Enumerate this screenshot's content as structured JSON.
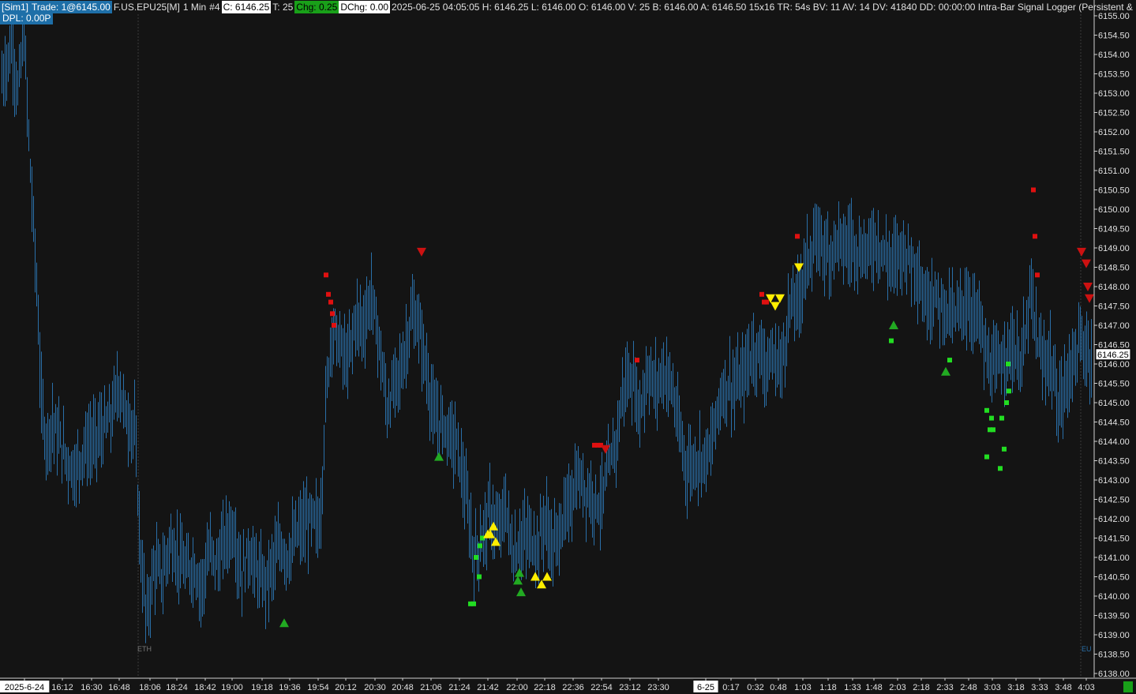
{
  "header": {
    "sim": "[Sim1]",
    "trade": "Trade: 1@6145.00",
    "symbol": "F.US.EPU25[M]",
    "timeframe": "1 Min",
    "bar_index": "#4",
    "close": "C: 6146.25",
    "ticks": "T: 25",
    "chg": "Chg: 0.25",
    "dchg": "DChg: 0.00",
    "info": "2025-06-25 04:05:05 H: 6146.25 L: 6146.00 O: 6146.00 V: 25 B: 6146.00 A: 6146.50 15x16 TR: 54s BV: 11 AV: 14 DV: 41840 DD: 00:00:00 Intra-Bar Signal Logger (Persistent & Precise)"
  },
  "dpl": "DPL: 0.00P",
  "session_labels": {
    "eth": "ETH",
    "eu": "EU"
  },
  "colors": {
    "background": "#141414",
    "bars": "#2a6fa8",
    "buy_square": "#22dd22",
    "sell_square": "#e01010",
    "buy_triangle": "#22aa22",
    "sell_triangle": "#cc1111",
    "alert_triangle": "#ffee00",
    "axis_text": "#e0e0e0"
  },
  "chart_data": {
    "type": "ohlc",
    "ylim": [
      6138.0,
      6155.2
    ],
    "y_ticks": [
      "6155.00",
      "6154.50",
      "6154.00",
      "6153.50",
      "6153.00",
      "6152.50",
      "6152.00",
      "6151.50",
      "6151.00",
      "6150.50",
      "6150.00",
      "6149.50",
      "6149.00",
      "6148.50",
      "6148.00",
      "6147.50",
      "6147.00",
      "6146.50",
      "6146.00",
      "6145.50",
      "6145.00",
      "6144.50",
      "6144.00",
      "6143.50",
      "6143.00",
      "6142.50",
      "6142.00",
      "6141.50",
      "6141.00",
      "6140.50",
      "6140.00",
      "6139.50",
      "6139.00",
      "6138.50",
      "6138.00"
    ],
    "current_price": "6146.25",
    "x_ticks": [
      "2025-6-24",
      "16:12",
      "16:30",
      "16:48",
      "18:06",
      "18:24",
      "18:42",
      "19:00",
      "19:18",
      "19:36",
      "19:54",
      "20:12",
      "20:30",
      "20:48",
      "21:06",
      "21:24",
      "21:42",
      "22:00",
      "22:18",
      "22:36",
      "22:54",
      "23:12",
      "23:30",
      "6-25",
      "0:17",
      "0:32",
      "0:48",
      "1:03",
      "1:18",
      "1:33",
      "1:48",
      "2:03",
      "2:18",
      "2:33",
      "2:48",
      "3:03",
      "3:18",
      "3:33",
      "3:48",
      "4:03"
    ],
    "price_path": [
      [
        0,
        6153.2
      ],
      [
        8,
        6153.8
      ],
      [
        15,
        6154.2
      ],
      [
        22,
        6153.0
      ],
      [
        30,
        6154.5
      ],
      [
        38,
        6151.0
      ],
      [
        45,
        6148.5
      ],
      [
        52,
        6145.0
      ],
      [
        58,
        6144.0
      ],
      [
        66,
        6144.5
      ],
      [
        75,
        6144.0
      ],
      [
        85,
        6143.5
      ],
      [
        95,
        6143.2
      ],
      [
        105,
        6143.8
      ],
      [
        118,
        6144.0
      ],
      [
        130,
        6144.3
      ],
      [
        140,
        6144.6
      ],
      [
        150,
        6145.5
      ],
      [
        160,
        6144.6
      ],
      [
        170,
        6144.3
      ],
      [
        178,
        6141.0
      ],
      [
        185,
        6139.4
      ],
      [
        195,
        6140.8
      ],
      [
        205,
        6140.5
      ],
      [
        215,
        6141.4
      ],
      [
        225,
        6141.0
      ],
      [
        235,
        6140.6
      ],
      [
        245,
        6140.8
      ],
      [
        255,
        6140.2
      ],
      [
        265,
        6141.2
      ],
      [
        275,
        6140.8
      ],
      [
        285,
        6141.5
      ],
      [
        295,
        6141.8
      ],
      [
        305,
        6140.5
      ],
      [
        315,
        6141.2
      ],
      [
        325,
        6140.6
      ],
      [
        335,
        6140.3
      ],
      [
        345,
        6140.8
      ],
      [
        355,
        6141.3
      ],
      [
        365,
        6141.0
      ],
      [
        375,
        6141.6
      ],
      [
        385,
        6141.8
      ],
      [
        395,
        6142.0
      ],
      [
        405,
        6141.8
      ],
      [
        412,
        6145.0
      ],
      [
        420,
        6147.0
      ],
      [
        430,
        6146.5
      ],
      [
        440,
        6146.0
      ],
      [
        450,
        6147.2
      ],
      [
        460,
        6147.0
      ],
      [
        470,
        6147.8
      ],
      [
        480,
        6146.5
      ],
      [
        490,
        6144.8
      ],
      [
        500,
        6145.5
      ],
      [
        510,
        6146.0
      ],
      [
        520,
        6147.2
      ],
      [
        530,
        6147.0
      ],
      [
        540,
        6145.8
      ],
      [
        550,
        6144.5
      ],
      [
        560,
        6144.5
      ],
      [
        570,
        6144.2
      ],
      [
        580,
        6143.8
      ],
      [
        590,
        6142.5
      ],
      [
        600,
        6141.0
      ],
      [
        610,
        6141.5
      ],
      [
        620,
        6142.2
      ],
      [
        630,
        6141.6
      ],
      [
        640,
        6142.3
      ],
      [
        650,
        6141.0
      ],
      [
        660,
        6141.5
      ],
      [
        670,
        6141.5
      ],
      [
        680,
        6141.3
      ],
      [
        690,
        6142.0
      ],
      [
        700,
        6141.2
      ],
      [
        710,
        6141.8
      ],
      [
        720,
        6142.3
      ],
      [
        730,
        6143.0
      ],
      [
        740,
        6142.8
      ],
      [
        750,
        6142.6
      ],
      [
        760,
        6142.4
      ],
      [
        770,
        6143.2
      ],
      [
        780,
        6144.0
      ],
      [
        790,
        6145.5
      ],
      [
        800,
        6145.6
      ],
      [
        810,
        6144.8
      ],
      [
        820,
        6145.8
      ],
      [
        830,
        6145.4
      ],
      [
        840,
        6145.8
      ],
      [
        850,
        6145.5
      ],
      [
        860,
        6144.2
      ],
      [
        870,
        6143.3
      ],
      [
        880,
        6143.5
      ],
      [
        890,
        6143.6
      ],
      [
        900,
        6143.8
      ],
      [
        910,
        6145.0
      ],
      [
        920,
        6145.5
      ],
      [
        930,
        6145.4
      ],
      [
        940,
        6145.6
      ],
      [
        950,
        6146.2
      ],
      [
        960,
        6146.4
      ],
      [
        970,
        6146.0
      ],
      [
        980,
        6146.1
      ],
      [
        990,
        6146.0
      ],
      [
        1000,
        6147.5
      ],
      [
        1010,
        6147.6
      ],
      [
        1020,
        6148.6
      ],
      [
        1030,
        6149.0
      ],
      [
        1040,
        6149.2
      ],
      [
        1050,
        6148.8
      ],
      [
        1060,
        6149.3
      ],
      [
        1070,
        6149.0
      ],
      [
        1080,
        6149.2
      ],
      [
        1090,
        6148.8
      ],
      [
        1100,
        6149.0
      ],
      [
        1110,
        6149.2
      ],
      [
        1120,
        6148.8
      ],
      [
        1130,
        6148.6
      ],
      [
        1140,
        6149.0
      ],
      [
        1150,
        6148.8
      ],
      [
        1160,
        6148.6
      ],
      [
        1170,
        6147.6
      ],
      [
        1180,
        6147.8
      ],
      [
        1190,
        6147.6
      ],
      [
        1200,
        6147.4
      ],
      [
        1210,
        6147.2
      ],
      [
        1220,
        6147.6
      ],
      [
        1230,
        6147.4
      ],
      [
        1240,
        6147.2
      ],
      [
        1250,
        6146.0
      ],
      [
        1260,
        6145.8
      ],
      [
        1270,
        6146.2
      ],
      [
        1280,
        6146.5
      ],
      [
        1290,
        6146.0
      ],
      [
        1300,
        6146.8
      ],
      [
        1305,
        6148.0
      ],
      [
        1310,
        6147.0
      ],
      [
        1320,
        6146.0
      ],
      [
        1330,
        6146.2
      ],
      [
        1340,
        6144.8
      ],
      [
        1350,
        6145.5
      ],
      [
        1360,
        6146.2
      ],
      [
        1370,
        6146.5
      ],
      [
        1380,
        6146.25
      ]
    ],
    "buy_squares": [
      [
        603,
        6141.0
      ],
      [
        607,
        6140.5
      ],
      [
        608,
        6141.3
      ],
      [
        611,
        6141.5
      ],
      [
        596,
        6139.8
      ],
      [
        600,
        6139.8
      ],
      [
        1129,
        6146.6
      ],
      [
        1203,
        6146.1
      ],
      [
        1277,
        6146.0
      ],
      [
        1250,
        6144.8
      ],
      [
        1254,
        6144.3
      ],
      [
        1256,
        6144.6
      ],
      [
        1258,
        6144.3
      ],
      [
        1269,
        6144.6
      ],
      [
        1272,
        6143.8
      ],
      [
        1275,
        6145.0
      ],
      [
        1278,
        6145.3
      ],
      [
        1250,
        6143.6
      ],
      [
        1267,
        6143.3
      ]
    ],
    "sell_squares": [
      [
        413,
        6148.3
      ],
      [
        416,
        6147.8
      ],
      [
        419,
        6147.6
      ],
      [
        421,
        6147.3
      ],
      [
        423,
        6147.0
      ],
      [
        753,
        6143.9
      ],
      [
        757,
        6143.9
      ],
      [
        761,
        6143.9
      ],
      [
        807,
        6146.1
      ],
      [
        965,
        6147.8
      ],
      [
        968,
        6147.6
      ],
      [
        971,
        6147.6
      ],
      [
        1010,
        6149.3
      ],
      [
        1309,
        6150.5
      ],
      [
        1311,
        6149.3
      ],
      [
        1314,
        6148.3
      ]
    ],
    "buy_triangles": [
      [
        360,
        6139.3
      ],
      [
        556,
        6143.6
      ],
      [
        656,
        6140.4
      ],
      [
        658,
        6140.6
      ],
      [
        660,
        6140.1
      ],
      [
        1132,
        6147.0
      ],
      [
        1198,
        6145.8
      ]
    ],
    "sell_triangles": [
      [
        534,
        6148.9
      ],
      [
        767,
        6143.8
      ],
      [
        1370,
        6148.9
      ],
      [
        1376,
        6148.6
      ],
      [
        1378,
        6148.0
      ],
      [
        1380,
        6147.7
      ]
    ],
    "alert_up_triangles": [
      [
        618,
        6141.6
      ],
      [
        621,
        6141.6
      ],
      [
        625,
        6141.8
      ],
      [
        628,
        6141.4
      ],
      [
        678,
        6140.5
      ],
      [
        686,
        6140.3
      ],
      [
        693,
        6140.5
      ]
    ],
    "alert_down_triangles": [
      [
        976,
        6147.7
      ],
      [
        982,
        6147.5
      ],
      [
        988,
        6147.7
      ],
      [
        1012,
        6148.5
      ]
    ]
  }
}
